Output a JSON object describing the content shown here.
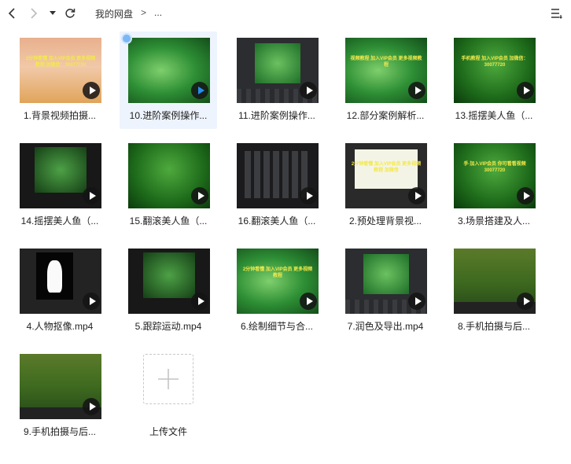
{
  "toolbar": {
    "back_icon": "chevron-left-icon",
    "forward_icon": "chevron-right-icon",
    "dropdown_icon": "caret-down-icon",
    "refresh_icon": "refresh-icon",
    "view_icon": "list-view-icon"
  },
  "breadcrumb": {
    "root": "我的网盘",
    "separator": ">",
    "current": "..."
  },
  "files": [
    {
      "label": "1.背景视频拍摄...",
      "scene": "s-warm",
      "overlay": "2分钟看懂 加入VIP会员 更多视频教程 加微信：30077720",
      "selected": false
    },
    {
      "label": "10.进阶案例操作...",
      "scene": "s-green",
      "overlay": "",
      "selected": true
    },
    {
      "label": "11.进阶案例操作...",
      "scene": "s-editor",
      "overlay": "",
      "selected": false
    },
    {
      "label": "12.部分案例解析...",
      "scene": "s-green",
      "overlay": "视频教程 加入VIP会员 更多视频教程",
      "selected": false
    },
    {
      "label": "13.摇摆美人鱼（...",
      "scene": "s-fern",
      "overlay": "手机教程 加入VIP会员 加微信：30077720",
      "selected": false
    },
    {
      "label": "14.摇摆美人鱼（...",
      "scene": "s-dark",
      "overlay": "",
      "selected": false
    },
    {
      "label": "15.翻滚美人鱼（...",
      "scene": "s-fern",
      "overlay": "",
      "selected": false
    },
    {
      "label": "16.翻滚美人鱼（...",
      "scene": "s-grid",
      "overlay": "",
      "selected": false
    },
    {
      "label": "2.预处理背景视...",
      "scene": "s-white",
      "overlay": "2分钟看懂 加入VIP会员 更多视频教程 加微信",
      "selected": false
    },
    {
      "label": "3.场景搭建及人...",
      "scene": "s-fern",
      "overlay": "手·加入VIP会员 你可看看视频 30077720",
      "selected": false
    },
    {
      "label": "4.人物抠像.mp4",
      "scene": "s-sil",
      "overlay": "",
      "selected": false
    },
    {
      "label": "5.跟踪运动.mp4",
      "scene": "s-dark",
      "overlay": "",
      "selected": false
    },
    {
      "label": "6.绘制细节与合...",
      "scene": "s-green",
      "overlay": "2分钟看懂 加入VIP会员 更多视频教程",
      "selected": false
    },
    {
      "label": "7.润色及导出.mp4",
      "scene": "s-editor",
      "overlay": "",
      "selected": false
    },
    {
      "label": "8.手机拍摄与后...",
      "scene": "s-forest",
      "overlay": "",
      "selected": false
    },
    {
      "label": "9.手机拍摄与后...",
      "scene": "s-forest",
      "overlay": "",
      "selected": false
    }
  ],
  "upload": {
    "label": "上传文件",
    "icon": "plus-icon"
  }
}
